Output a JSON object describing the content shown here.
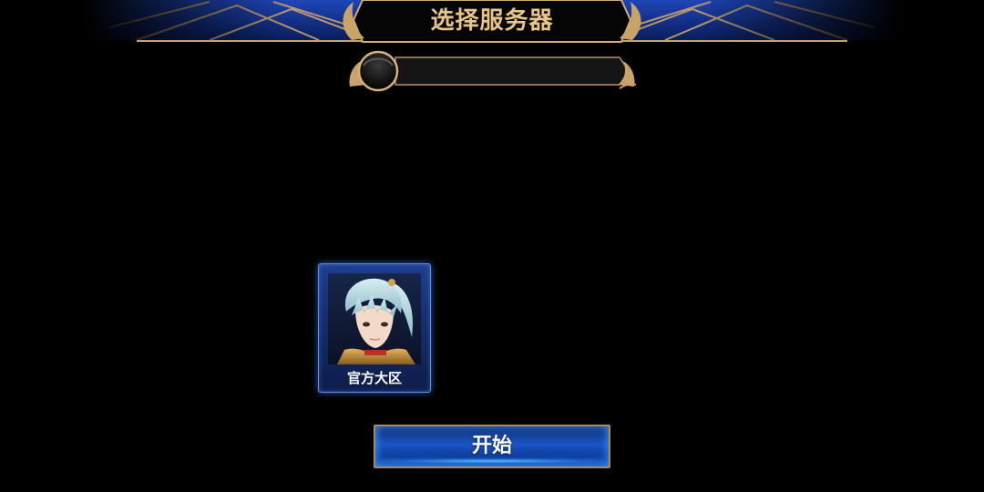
{
  "header": {
    "title": "选择服务器"
  },
  "current_server": {
    "name": ""
  },
  "server_list": [
    {
      "label": "官方大区"
    }
  ],
  "actions": {
    "start_label": "开始"
  },
  "colors": {
    "background": "#000000",
    "gold_text": "#e9c48a",
    "gold_frame": "#b08a55",
    "card_border": "#5f8ef0",
    "button_blue": "#1a55c4"
  },
  "icons": {
    "server_status": "server-status-orb-icon",
    "portrait": "character-portrait"
  }
}
